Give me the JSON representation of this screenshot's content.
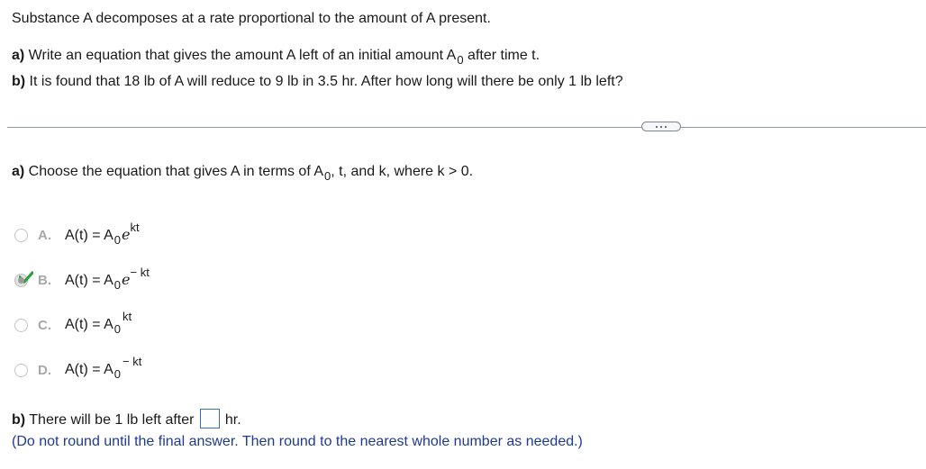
{
  "problem": {
    "intro": "Substance A decomposes at a rate proportional to the amount of A present.",
    "part_a": {
      "label": "a)",
      "text_before": " Write an equation that gives the amount A left of an initial amount A",
      "sub": "0",
      "text_after": " after time t."
    },
    "part_b": {
      "label": "b)",
      "text": " It is found that 18 lb of A will reduce to 9 lb in 3.5 hr. After how long will there be only 1 lb left?"
    }
  },
  "separator": {
    "more_icon": "ellipsis-icon"
  },
  "question_a": {
    "label": "a)",
    "text_before": " Choose the equation that gives A in terms of A",
    "sub": "0",
    "text_after": ", t, and k, where k > 0."
  },
  "choices": [
    {
      "letter": "A.",
      "lhs": "A(t) = A",
      "sub": "0",
      "base": "e",
      "exp": "kt",
      "selected": false,
      "correct": false
    },
    {
      "letter": "B.",
      "lhs": "A(t) = A",
      "sub": "0",
      "base": "e",
      "exp": "− kt",
      "selected": true,
      "correct": true
    },
    {
      "letter": "C.",
      "lhs": "A(t) = A",
      "sub": "0",
      "base": "",
      "exp": "kt",
      "selected": false,
      "correct": false
    },
    {
      "letter": "D.",
      "lhs": "A(t) = A",
      "sub": "0",
      "base": "",
      "exp": "− kt",
      "selected": false,
      "correct": false
    }
  ],
  "question_b": {
    "label": "b)",
    "text_before": " There will be 1 lb left after ",
    "answer_value": "",
    "text_after": "hr.",
    "hint": "(Do not round until the final answer. Then round to the nearest whole number as needed.)"
  },
  "colors": {
    "hint_text": "#1f3a93",
    "answer_border": "#3b6fc4",
    "check_green": "#2e9e3e"
  }
}
